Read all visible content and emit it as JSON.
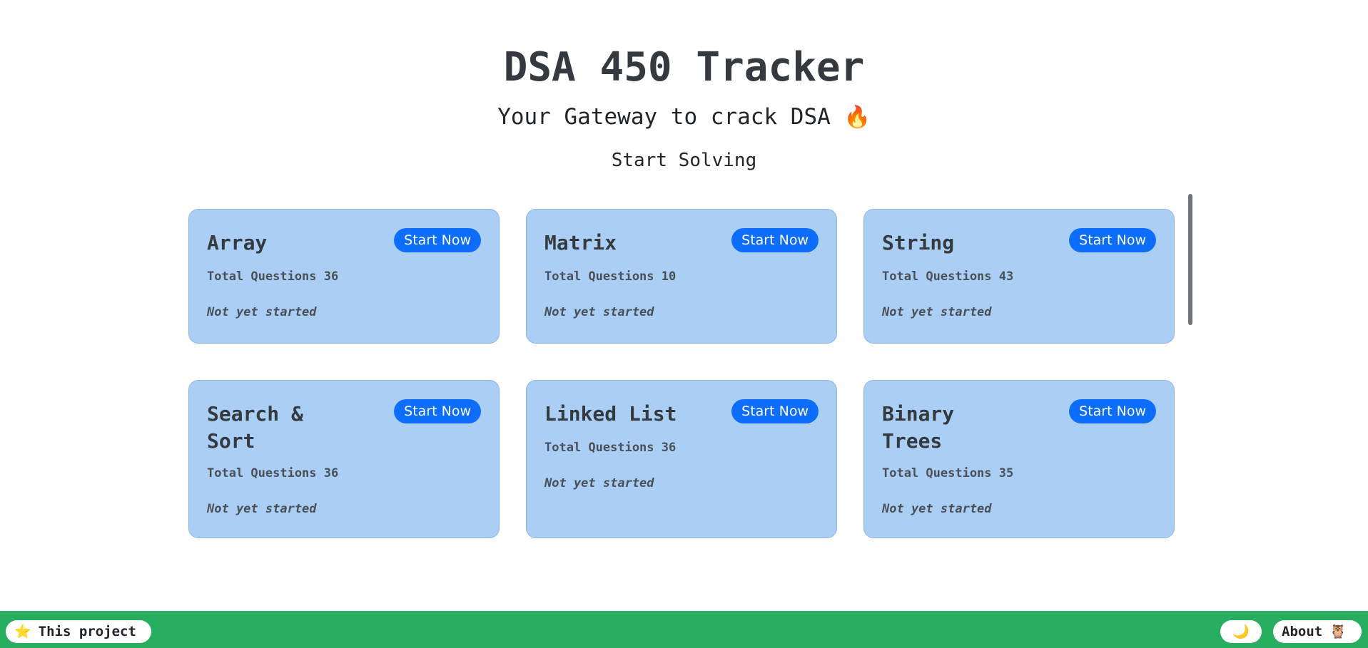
{
  "header": {
    "title": "DSA 450 Tracker",
    "subtitle": "Your Gateway to crack DSA",
    "subtitle_emoji": "🔥",
    "start_solving": "Start Solving"
  },
  "cards": [
    {
      "title": "Array",
      "button": "Start Now",
      "total": "Total Questions 36",
      "status": "Not yet started"
    },
    {
      "title": "Matrix",
      "button": "Start Now",
      "total": "Total Questions 10",
      "status": "Not yet started"
    },
    {
      "title": "String",
      "button": "Start Now",
      "total": "Total Questions 43",
      "status": "Not yet started"
    },
    {
      "title": "Search & Sort",
      "button": "Start Now",
      "total": "Total Questions 36",
      "status": "Not yet started"
    },
    {
      "title": "Linked List",
      "button": "Start Now",
      "total": "Total Questions 36",
      "status": "Not yet started"
    },
    {
      "title": "Binary Trees",
      "button": "Start Now",
      "total": "Total Questions 35",
      "status": "Not yet started"
    }
  ],
  "footer": {
    "project_icon": "⭐",
    "project_label": "This project",
    "theme_icon": "🌙",
    "about_label": "About",
    "about_icon": "🦉"
  },
  "colors": {
    "card_bg": "#abcff4",
    "button_bg": "#0d6efd",
    "footer_bg": "#27ae60"
  }
}
